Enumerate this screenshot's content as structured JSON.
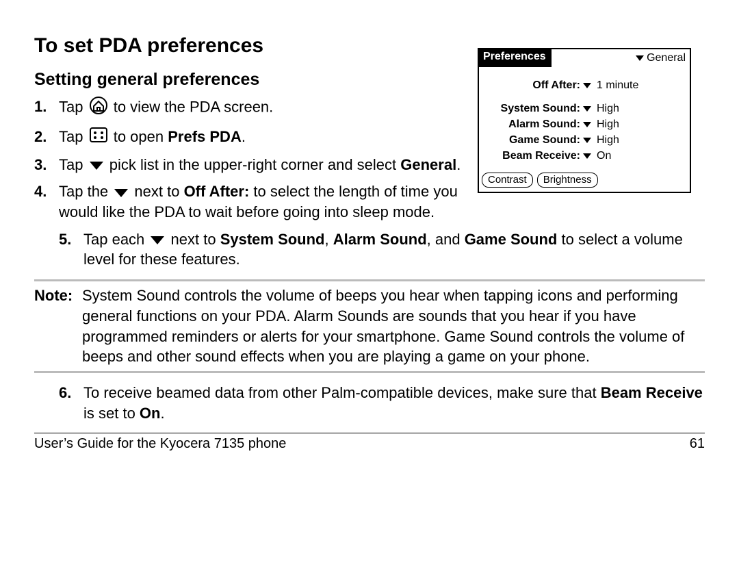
{
  "title": "To set PDA preferences",
  "subtitle": "Setting general preferences",
  "steps": {
    "s1": {
      "num": "1.",
      "a": "Tap ",
      "b": " to view the PDA screen."
    },
    "s2": {
      "num": "2.",
      "a": "Tap ",
      "b": " to open ",
      "bold": "Prefs PDA",
      "c": "."
    },
    "s3": {
      "num": "3.",
      "a": "Tap ",
      "b": " pick list in the upper-right corner and select ",
      "bold": "General",
      "c": "."
    },
    "s4": {
      "num": "4.",
      "a": "Tap the ",
      "b": " next to ",
      "bold": "Off After:",
      "c": " to select the length of time you would like the PDA to wait before going into sleep mode."
    },
    "s5": {
      "num": "5.",
      "a": "Tap each ",
      "b": " next to ",
      "bold1": "System Sound",
      "sep1": ", ",
      "bold2": "Alarm Sound",
      "sep2": ", and ",
      "bold3": "Game Sound",
      "c": " to select a volume level for these features."
    },
    "s6": {
      "num": "6.",
      "a": "To receive beamed data from other Palm-compatible devices, make sure that ",
      "bold": "Beam Receive",
      "b": " is set to ",
      "bold2": "On",
      "c": "."
    }
  },
  "note": {
    "label": "Note:",
    "text": "System Sound controls the volume of beeps you hear when tapping icons and performing general functions on your PDA. Alarm Sounds are sounds that you hear if you have programmed reminders or alerts for your smartphone. Game Sound controls the volume of beeps and other sound effects when you are playing a game on your phone."
  },
  "footer": {
    "left": "User’s Guide for the Kyocera 7135 phone",
    "right": "61"
  },
  "pda": {
    "title": "Preferences",
    "category": "General",
    "rows": {
      "offAfter": {
        "label": "Off After:",
        "value": "1 minute"
      },
      "systemSound": {
        "label": "System Sound:",
        "value": "High"
      },
      "alarmSound": {
        "label": "Alarm Sound:",
        "value": "High"
      },
      "gameSound": {
        "label": "Game Sound:",
        "value": "High"
      },
      "beamReceive": {
        "label": "Beam Receive:",
        "value": "On"
      }
    },
    "buttons": {
      "contrast": "Contrast",
      "brightness": "Brightness"
    }
  }
}
